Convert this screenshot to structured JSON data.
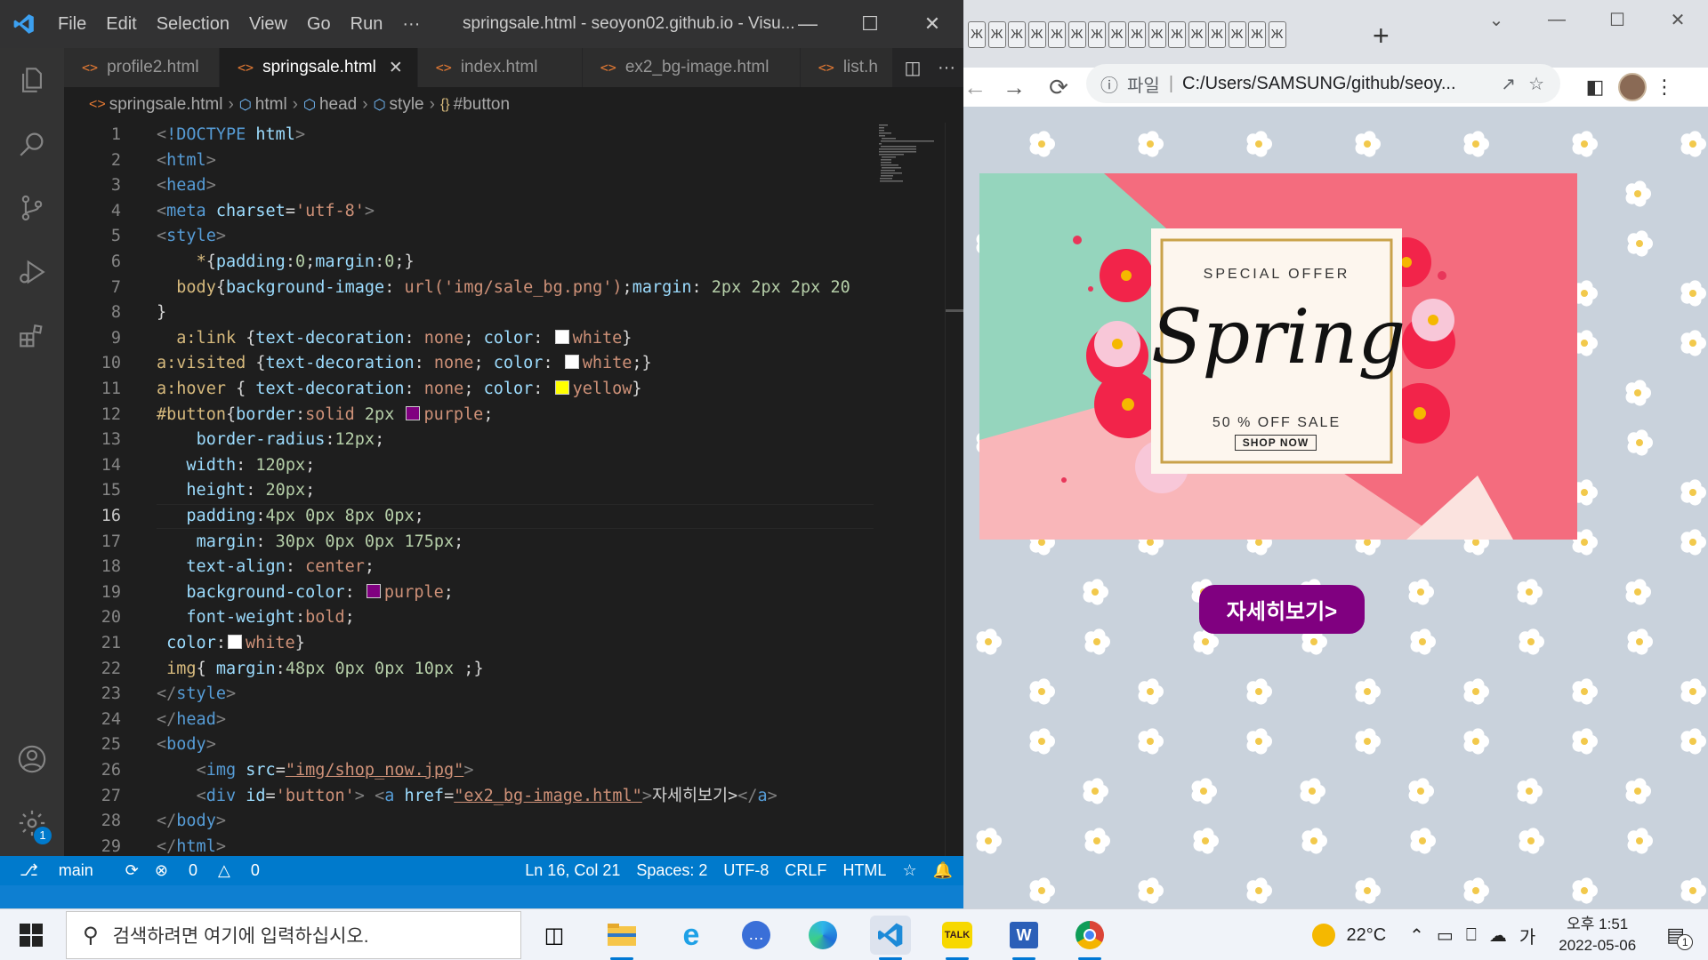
{
  "vscode": {
    "menu": [
      "File",
      "Edit",
      "Selection",
      "View",
      "Go",
      "Run",
      "···"
    ],
    "window_title": "springsale.html - seoyon02.github.io - Visu...",
    "tabs": [
      {
        "label": "profile2.html"
      },
      {
        "label": "springsale.html",
        "active": true
      },
      {
        "label": "index.html"
      },
      {
        "label": "ex2_bg-image.html"
      },
      {
        "label": "list.h"
      }
    ],
    "breadcrumb": [
      "springsale.html",
      "html",
      "head",
      "style",
      "#button"
    ],
    "current_line": 16,
    "status": {
      "branch": "main",
      "errors": "0",
      "warnings": "0",
      "position": "Ln 16, Col 21",
      "spaces": "Spaces: 2",
      "encoding": "UTF-8",
      "eol": "CRLF",
      "language": "HTML"
    },
    "settings_badge": "1"
  },
  "chrome": {
    "address_prefix": "파일",
    "address": "C:/Users/SAMSUNG/github/seoy...",
    "page": {
      "banner": {
        "top": "SPECIAL OFFER",
        "title": "Spring",
        "subtitle": "50 % OFF SALE",
        "cta": "SHOP NOW"
      },
      "button": "자세히보기>"
    }
  },
  "taskbar": {
    "search_placeholder": "검색하려면 여기에 입력하십시오.",
    "temperature": "22°C",
    "ime": "가",
    "time": "오후 1:51",
    "date": "2022-05-06",
    "notif_count": "1"
  }
}
